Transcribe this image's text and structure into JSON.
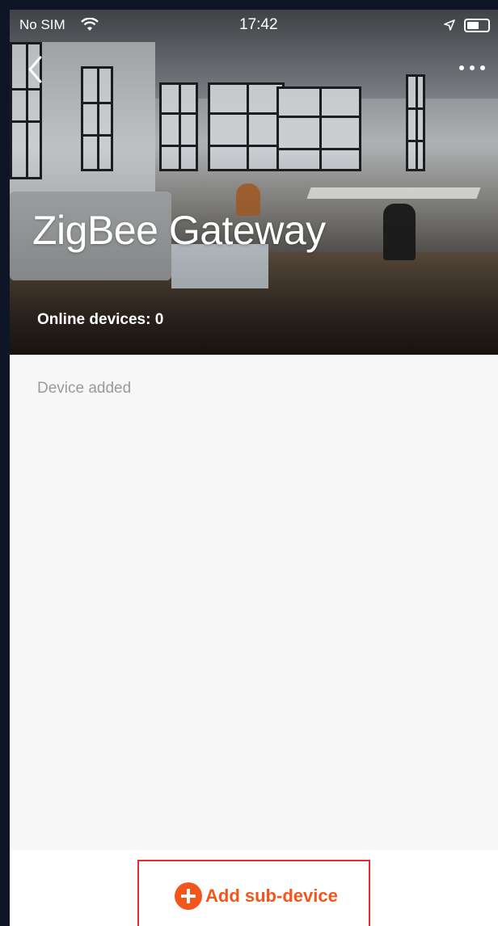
{
  "status_bar": {
    "carrier": "No SIM",
    "time": "17:42",
    "wifi_icon": "wifi-icon",
    "location_icon": "location-arrow-icon",
    "battery_icon": "battery-icon"
  },
  "header": {
    "back_icon": "chevron-left-icon",
    "more_icon": "more-dots-icon",
    "title": "ZigBee Gateway",
    "online_devices": "Online devices: 0"
  },
  "main": {
    "section_label": "Device added"
  },
  "footer": {
    "add_button_label": "Add sub-device",
    "add_icon": "plus-circle-icon",
    "accent_color": "#f2561d",
    "highlight_color": "#e52b2b"
  }
}
